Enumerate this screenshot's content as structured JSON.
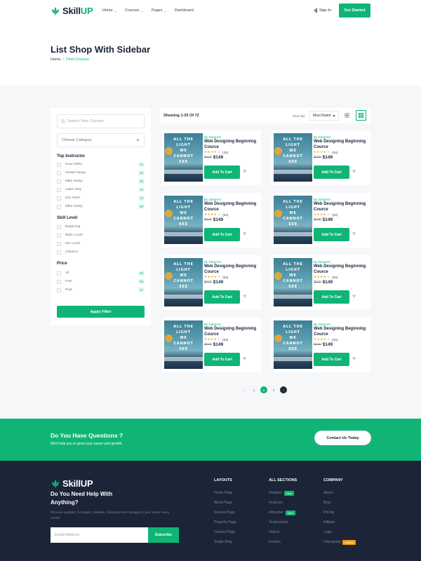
{
  "brand": {
    "name_a": "Skill",
    "name_b": "UP"
  },
  "nav": {
    "items": [
      {
        "label": "Home",
        "caret": "⌄"
      },
      {
        "label": "Courses",
        "caret": "⌄"
      },
      {
        "label": "Pages",
        "caret": "⌄"
      },
      {
        "label": "Dashboard",
        "caret": ""
      }
    ],
    "signin": "Sign In",
    "get_started": "Get Started"
  },
  "hero": {
    "title": "List Shop With Sidebar",
    "crumb_home": "Home",
    "crumb_sep": "/",
    "crumb_current": "Find Courses"
  },
  "sidebar": {
    "search_placeholder": "Search Your Courses",
    "category_placeholder": "Choose Category",
    "instructor_title": "Top Instructor",
    "instructors": [
      {
        "name": "Kevy White",
        "count": "22"
      },
      {
        "name": "Hinata Hyuga",
        "count": "22"
      },
      {
        "name": "Mike Hussy",
        "count": "55"
      },
      {
        "name": "Adam Riky",
        "count": "42"
      },
      {
        "name": "Dev Patel",
        "count": "13"
      },
      {
        "name": "Mike Hussy",
        "count": "56"
      }
    ],
    "level_title": "Skill Level",
    "levels": [
      "Beginning",
      "Basic Level",
      "Iten Level",
      "Advance"
    ],
    "price_title": "Price",
    "prices": [
      {
        "name": "All",
        "count": "69"
      },
      {
        "name": "Free",
        "count": "56"
      },
      {
        "name": "Paid",
        "count": "41"
      }
    ],
    "apply": "Apply Filter"
  },
  "toolbar": {
    "showing": "Showing 1-25 Of 72",
    "sort_label": "Short By:",
    "sort_value": "Most Rated"
  },
  "course": {
    "cover_lines": [
      "ALL THE",
      "LIGHT",
      "WE",
      "CANNOT",
      "SEE"
    ],
    "by": "By Dargrest",
    "title": "Web Designing Beginning Cource",
    "stars": "★★★★",
    "star_off": "★",
    "rating_count": "(34)",
    "old_price": "$220",
    "price": "$149",
    "cart": "Add To Cart",
    "count": 8
  },
  "pagination": {
    "prev": "‹",
    "pages": [
      "1",
      "2",
      "3"
    ],
    "active": "2",
    "next": "›"
  },
  "cta": {
    "title": "Do You Have Questions ?",
    "subtitle": "We'll help you to grow your career and growth.",
    "button": "Contact Us Today"
  },
  "footer": {
    "heading": "Do You Need Help With Anything?",
    "desc": "Receive updates, hot deals, tutorials, discounts sent straignt in your inbox every month",
    "email_placeholder": "Email Address",
    "subscribe": "Subscribe",
    "columns": [
      {
        "title": "LAYOUTS",
        "links": [
          {
            "label": "Home Page"
          },
          {
            "label": "About Page"
          },
          {
            "label": "Service Page"
          },
          {
            "label": "Property Page"
          },
          {
            "label": "Contact Page"
          },
          {
            "label": "Single Blog"
          }
        ]
      },
      {
        "title": "ALL SECTIONS",
        "links": [
          {
            "label": "Headers",
            "tag": "New",
            "tag_color": "green"
          },
          {
            "label": "Features"
          },
          {
            "label": "Attractive",
            "tag": "New",
            "tag_color": "green"
          },
          {
            "label": "Testimonials"
          },
          {
            "label": "Videos"
          },
          {
            "label": "Footers"
          }
        ]
      },
      {
        "title": "COMPANY",
        "links": [
          {
            "label": "About"
          },
          {
            "label": "Blog"
          },
          {
            "label": "Pricing"
          },
          {
            "label": "Affiliate"
          },
          {
            "label": "Login"
          },
          {
            "label": "Changelog",
            "tag": "Update",
            "tag_color": "orange"
          }
        ]
      }
    ]
  },
  "colors": {
    "accent": "#10b576",
    "dark": "#1c2438",
    "title": "#1a2239"
  },
  "icons": {
    "logo": "leaf-logo-icon",
    "signin": "sign-in-icon",
    "search": "search-icon",
    "grid": "grid-view-icon",
    "list": "list-view-icon",
    "heart": "heart-icon"
  }
}
